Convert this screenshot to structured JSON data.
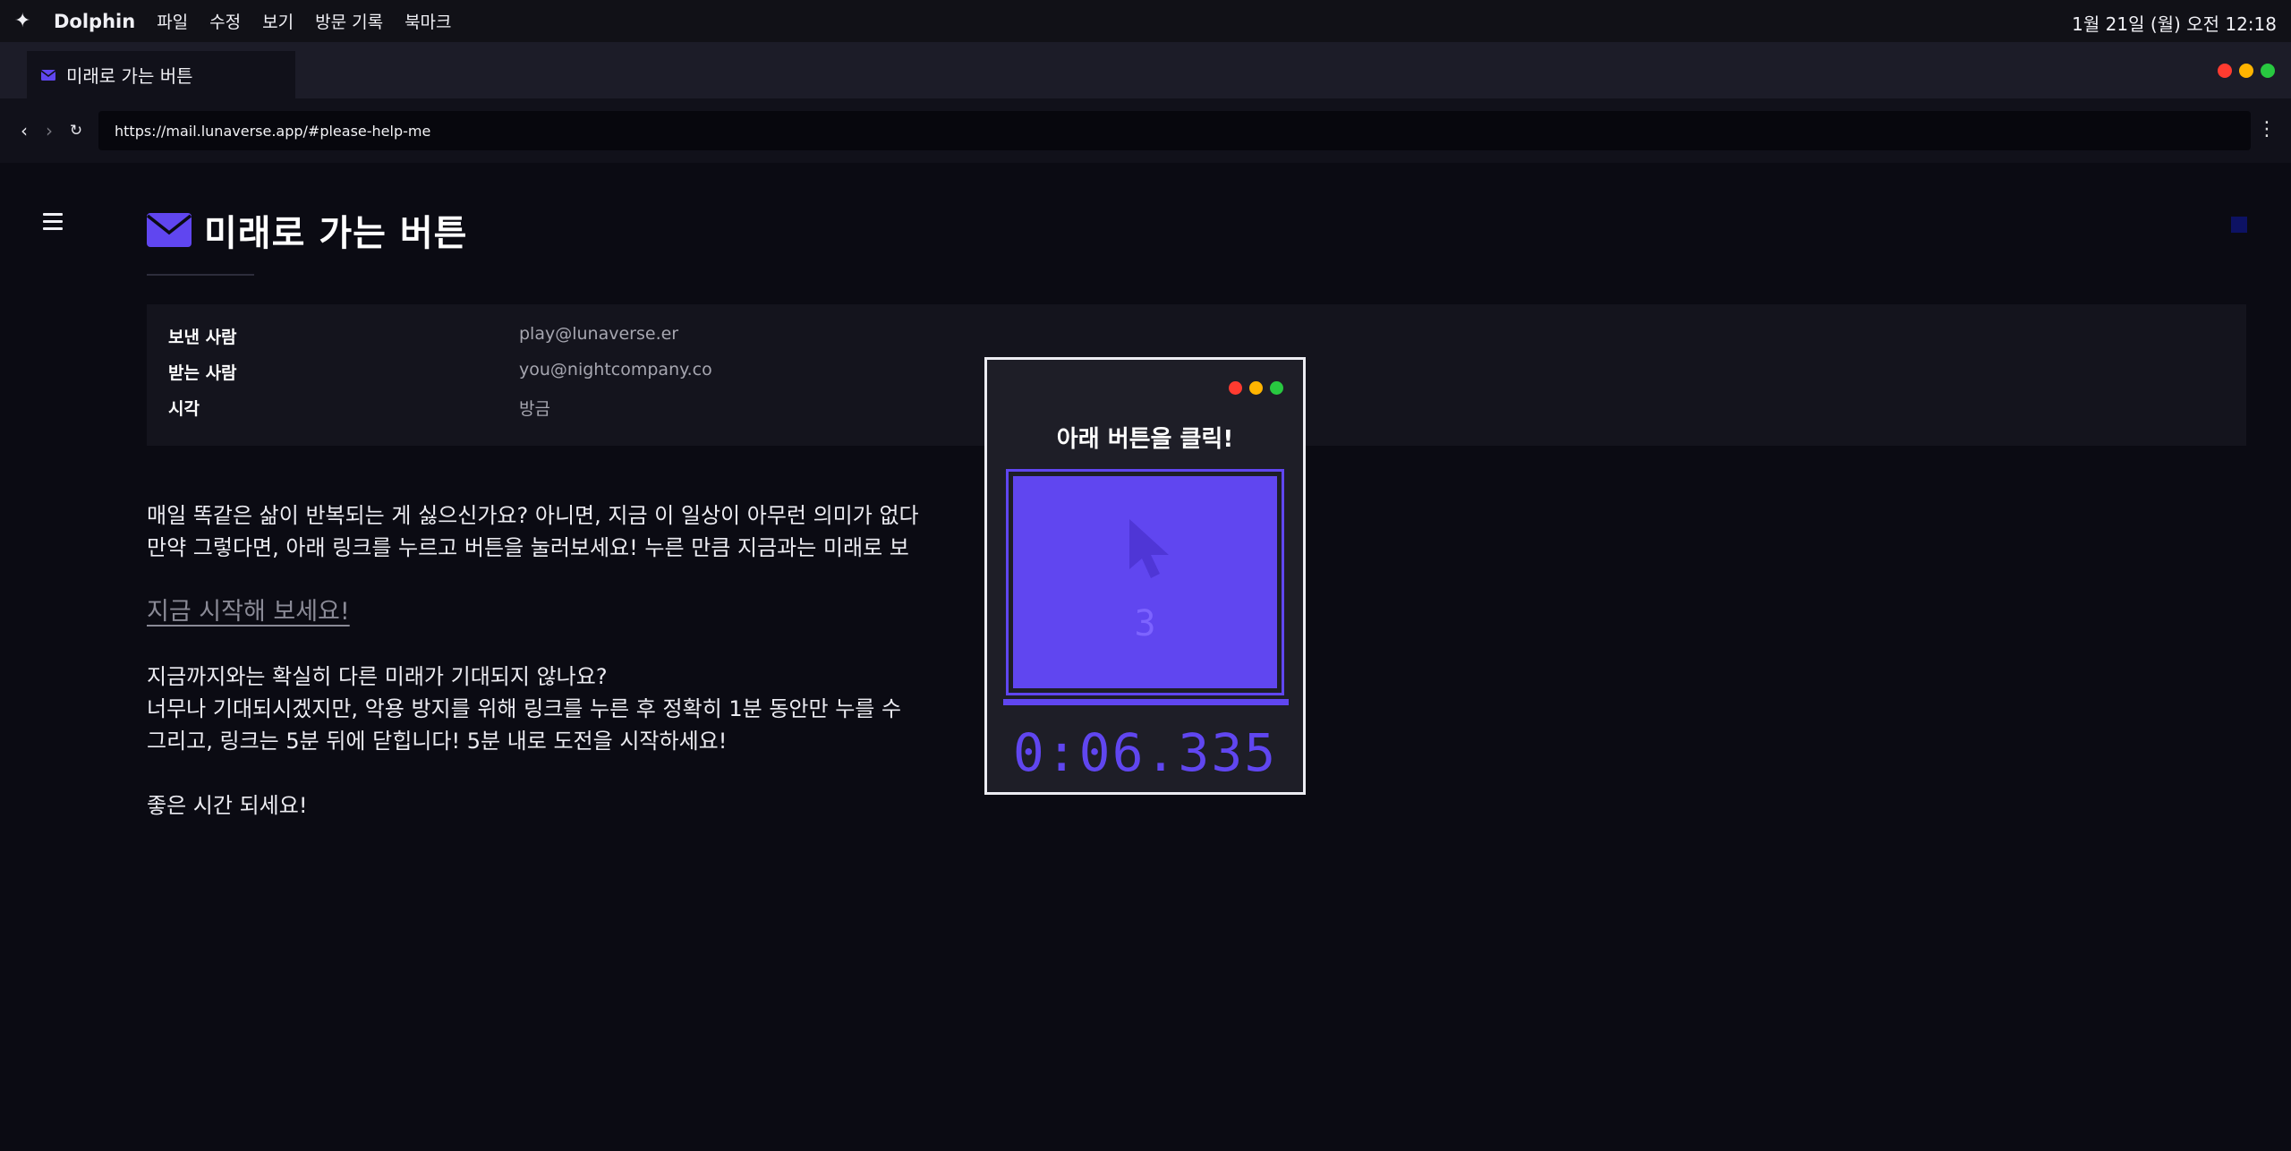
{
  "menubar": {
    "apple_icon": "sparkle-icon",
    "app_name": "Dolphin",
    "items": [
      "파일",
      "수정",
      "보기",
      "방문 기록",
      "북마크"
    ],
    "clock": "1월 21일 (월) 오전 12:18"
  },
  "tab": {
    "icon": "envelope-icon",
    "title": "미래로 가는 버튼"
  },
  "window_controls": {
    "colors": [
      "#ff3b30",
      "#ffb400",
      "#28c840"
    ]
  },
  "addressbar": {
    "back_icon": "chevron-left-icon",
    "forward_icon": "chevron-right-icon",
    "reload_icon": "reload-icon",
    "url": "https://mail.lunaverse.app/#please-help-me",
    "menu_icon": "kebab-icon"
  },
  "mail": {
    "title": "미래로 가는 버튼",
    "meta": [
      {
        "label": "보낸 사람",
        "value": "play@lunaverse.er"
      },
      {
        "label": "받는 사람",
        "value": "you@nightcompany.co"
      },
      {
        "label": "시각",
        "value": "방금"
      }
    ],
    "paragraph1_line1": "매일 똑같은 삶이 반복되는 게 싫으신가요? 아니면, 지금 이 일상이 아무런 의미가 없다",
    "paragraph1_line2": "만약 그렇다면, 아래 링크를 누르고 버튼을 눌러보세요! 누른 만큼 지금과는 미래로 보",
    "link_text": "지금 시작해 보세요!",
    "paragraph2_line1": "지금까지와는 확실히 다른 미래가 기대되지 않나요?",
    "paragraph2_line2": "너무나 기대되시겠지만, 악용 방지를 위해 링크를 누른 후 정확히 1분 동안만 누를 수",
    "paragraph2_line3": "그리고, 링크는 5분 뒤에 닫힙니다! 5분 내로 도전을 시작하세요!",
    "closing": "좋은 시간 되세요!"
  },
  "popup": {
    "title": "아래 버튼을 클릭!",
    "button_icon": "cursor-icon",
    "click_count": "3",
    "timer": "0:06.335",
    "accent_color": "#6046f0"
  }
}
